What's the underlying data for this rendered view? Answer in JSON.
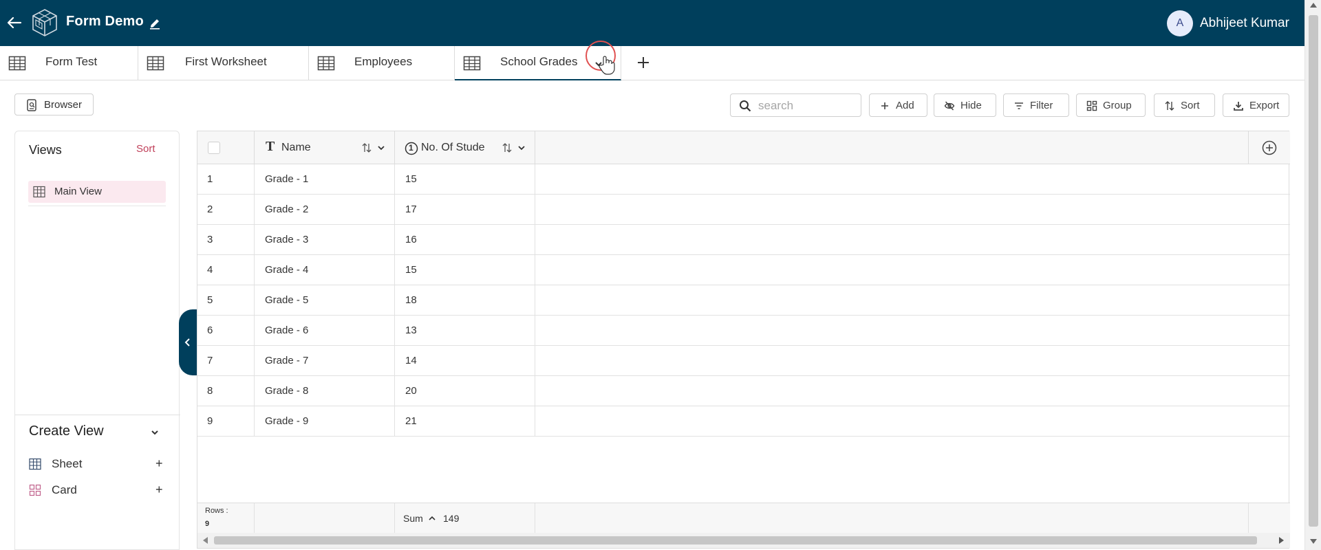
{
  "header": {
    "title": "Form Demo",
    "user_initial": "A",
    "user_name": "Abhijeet Kumar"
  },
  "tabs": [
    {
      "label": "Form Test"
    },
    {
      "label": "First Worksheet"
    },
    {
      "label": "Employees"
    },
    {
      "label": "School Grades"
    }
  ],
  "toolbar": {
    "browser_label": "Browser",
    "search_placeholder": "search",
    "add_label": "Add",
    "hide_label": "Hide",
    "filter_label": "Filter",
    "group_label": "Group",
    "sort_label": "Sort",
    "export_label": "Export"
  },
  "views": {
    "title": "Views",
    "sort_label": "Sort",
    "items": [
      {
        "label": "Main View"
      }
    ],
    "create_title": "Create View",
    "create_items": [
      {
        "label": "Sheet",
        "plus": "+"
      },
      {
        "label": "Card",
        "plus": "+"
      }
    ]
  },
  "table": {
    "columns": [
      {
        "label": "Name",
        "type_glyph": "T"
      },
      {
        "label": "No. Of Stude",
        "type_glyph": "1"
      }
    ],
    "rows": [
      {
        "index": "1",
        "name": "Grade - 1",
        "count": "15"
      },
      {
        "index": "2",
        "name": "Grade - 2",
        "count": "17"
      },
      {
        "index": "3",
        "name": "Grade - 3",
        "count": "16"
      },
      {
        "index": "4",
        "name": "Grade - 4",
        "count": "15"
      },
      {
        "index": "5",
        "name": "Grade - 5",
        "count": "18"
      },
      {
        "index": "6",
        "name": "Grade - 6",
        "count": "13"
      },
      {
        "index": "7",
        "name": "Grade - 7",
        "count": "14"
      },
      {
        "index": "8",
        "name": "Grade - 8",
        "count": "20"
      },
      {
        "index": "9",
        "name": "Grade - 9",
        "count": "21"
      }
    ],
    "footer": {
      "rows_label": "Rows :",
      "rows_count": "9",
      "agg_label": "Sum",
      "agg_value": "149"
    }
  },
  "colors": {
    "header_bg": "#003f5c",
    "accent": "#c0405a",
    "selected_view_bg": "#fbe9ef"
  },
  "icons": [
    "back-arrow-icon",
    "logo-icon",
    "pencil-icon",
    "grid-icon",
    "chevron-down-icon",
    "plus-icon",
    "search-icon",
    "eye-off-icon",
    "filter-icon",
    "group-icon",
    "sort-icon",
    "download-icon",
    "card-icon",
    "add-column-icon",
    "chevron-left-icon"
  ]
}
